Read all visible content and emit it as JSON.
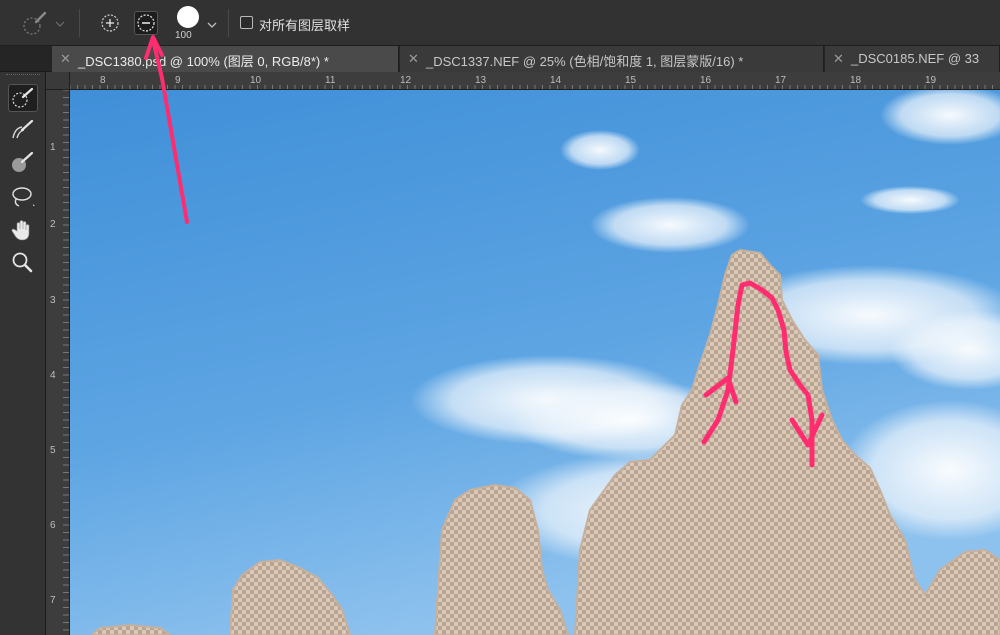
{
  "options_bar": {
    "brush_size": "100",
    "sample_all_layers_label": "对所有图层取样",
    "sample_all_layers_checked": false,
    "selected_mode": "subtract-from-selection"
  },
  "tabs": [
    {
      "label": "_DSC1380.psd @ 100% (图层 0, RGB/8*) *",
      "active": true
    },
    {
      "label": "_DSC1337.NEF @ 25% (色相/饱和度 1, 图层蒙版/16) *",
      "active": false
    },
    {
      "label": "_DSC0185.NEF @ 33",
      "active": false
    }
  ],
  "panel_collapse_glyph": "››",
  "tools": [
    {
      "icon": "quick-selection-icon",
      "active": true
    },
    {
      "icon": "select-and-mask-brush-icon",
      "active": false
    },
    {
      "icon": "object-selection-brush-icon",
      "active": false
    },
    {
      "icon": "lasso-icon",
      "active": false
    },
    {
      "icon": "hand-icon",
      "active": false
    },
    {
      "icon": "zoom-icon",
      "active": false
    }
  ],
  "ruler_top": [
    "8",
    "9",
    "10",
    "11",
    "12",
    "13",
    "14",
    "15",
    "16",
    "17",
    "18",
    "19"
  ],
  "ruler_left": [
    "1",
    "2",
    "3",
    "4",
    "5",
    "6",
    "7"
  ],
  "colors": {
    "annotation": "#ff2d6f",
    "sky_top": "#3f8fd8",
    "sky_bottom": "#8ec2ee",
    "rock": "#d9c4b0"
  }
}
